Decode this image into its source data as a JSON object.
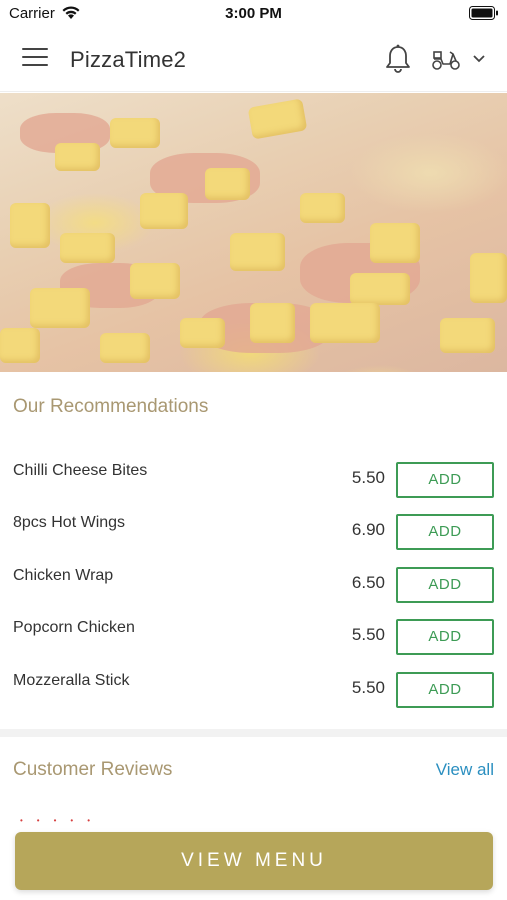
{
  "status_bar": {
    "carrier": "Carrier",
    "time": "3:00 PM"
  },
  "header": {
    "title": "PizzaTime2",
    "icons": [
      "menu-icon",
      "bell-icon",
      "scooter-icon",
      "chevron-down-icon"
    ]
  },
  "recommendations": {
    "title": "Our Recommendations",
    "items": [
      {
        "name": "Chilli Cheese Bites",
        "price": "5.50",
        "action": "ADD"
      },
      {
        "name": "8pcs Hot Wings",
        "price": "6.90",
        "action": "ADD"
      },
      {
        "name": "Chicken Wrap",
        "price": "6.50",
        "action": "ADD"
      },
      {
        "name": "Popcorn Chicken",
        "price": "5.50",
        "action": "ADD"
      },
      {
        "name": "Mozzeralla Stick",
        "price": "5.50",
        "action": "ADD"
      }
    ]
  },
  "reviews": {
    "title": "Customer Reviews",
    "view_all": "View all"
  },
  "footer": {
    "cta_label": "VIEW MENU"
  },
  "colors": {
    "accent_gold": "#b6a65a",
    "section_title": "#a99872",
    "add_green": "#3d9b55",
    "link_blue": "#2b8fc0"
  }
}
